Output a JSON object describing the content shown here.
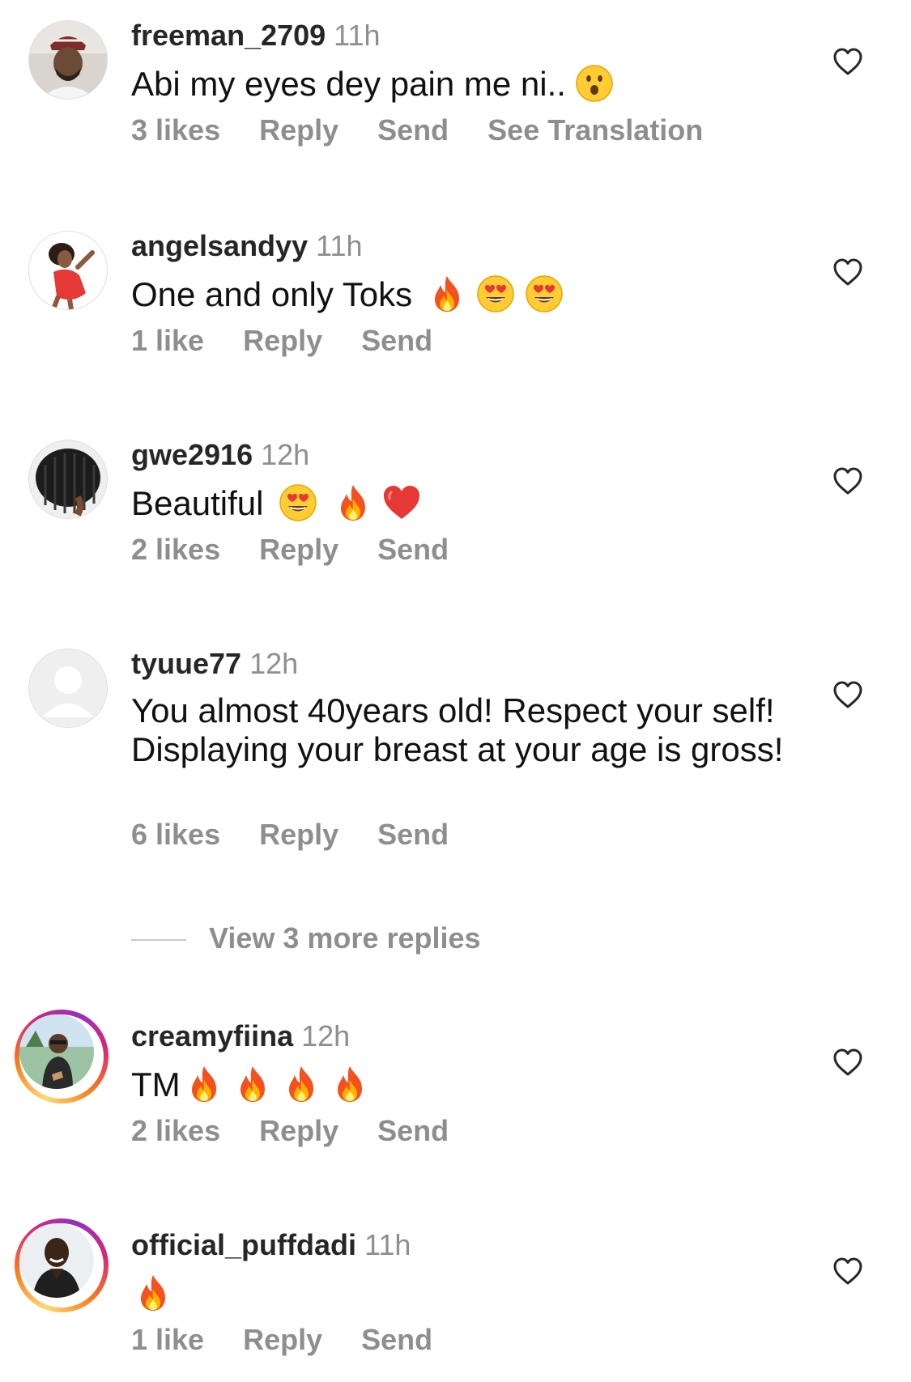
{
  "colors": {
    "text_primary": "#262626",
    "text_secondary": "#8e8e8e",
    "story_ring": [
      "#feda75",
      "#fa7e1e",
      "#d62976",
      "#962fbf"
    ]
  },
  "comments": [
    {
      "username": "freeman_2709",
      "time": "11h",
      "text": "Abi my eyes dey pain me ni..",
      "emojis": [
        "hushed-face-emoji"
      ],
      "likes": "3 likes",
      "reply": "Reply",
      "send": "Send",
      "translate": "See Translation",
      "avatar_icon": "user-photo-avatar"
    },
    {
      "username": "angelsandyy",
      "time": "11h",
      "text": "One and only Toks",
      "emojis": [
        "fire-emoji",
        "heart-eyes-emoji",
        "heart-eyes-emoji"
      ],
      "likes": "1 like",
      "reply": "Reply",
      "send": "Send",
      "avatar_icon": "user-photo-avatar"
    },
    {
      "username": "gwe2916",
      "time": "12h",
      "text": "Beautiful",
      "emojis": [
        "heart-eyes-emoji",
        "fire-emoji",
        "red-heart-emoji"
      ],
      "likes": "2 likes",
      "reply": "Reply",
      "send": "Send",
      "avatar_icon": "user-photo-avatar"
    },
    {
      "username": "tyuue77",
      "time": "12h",
      "text": "You almost 40years old! Respect your self! Displaying your breast at your age is gross!",
      "emojis": [],
      "likes": "6 likes",
      "reply": "Reply",
      "send": "Send",
      "avatar_icon": "default-avatar-icon"
    },
    {
      "username": "creamyfiina",
      "time": "12h",
      "text": "TM",
      "emojis": [
        "fire-emoji",
        "fire-emoji",
        "fire-emoji",
        "fire-emoji"
      ],
      "likes": "2 likes",
      "reply": "Reply",
      "send": "Send",
      "avatar_icon": "user-photo-avatar"
    },
    {
      "username": "official_puffdadi",
      "time": "11h",
      "text": "",
      "emojis": [
        "fire-emoji"
      ],
      "likes": "1 like",
      "reply": "Reply",
      "send": "Send",
      "avatar_icon": "user-photo-avatar"
    }
  ],
  "view_more_replies": "View 3 more replies"
}
